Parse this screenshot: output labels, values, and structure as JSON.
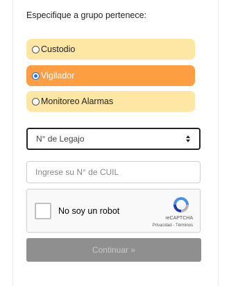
{
  "form": {
    "prompt": "Especifique a grupo pertenece:",
    "groups": [
      {
        "label": "Custodio",
        "selected": false
      },
      {
        "label": "Vigilador",
        "selected": true
      },
      {
        "label": "Monitoreo Alarmas",
        "selected": false
      }
    ],
    "legajo_select": {
      "selected": "N° de Legajo"
    },
    "cuil_input": {
      "placeholder": "Ingrese su N° de CUIL",
      "value": ""
    },
    "recaptcha": {
      "label": "No soy un robot",
      "brand": "reCAPTCHA",
      "links": "Privacidad - Términos"
    },
    "continue_label": "Continuar »"
  },
  "colors": {
    "option_bg": "#fee6a5",
    "option_selected_bg": "#fd9e43",
    "button_bg": "#8f8f8f"
  }
}
